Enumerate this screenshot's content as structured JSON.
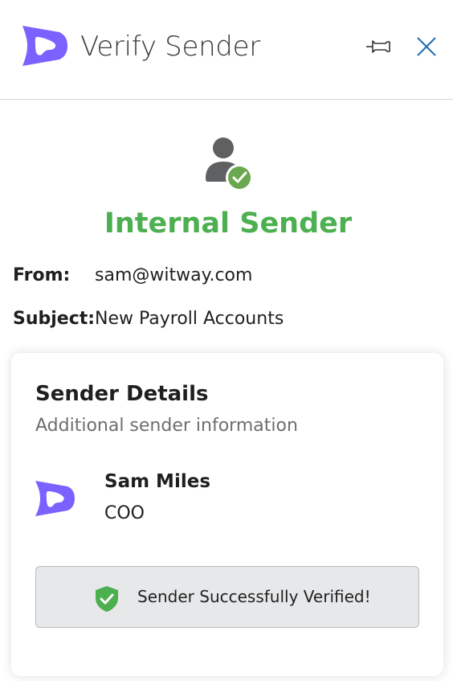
{
  "header": {
    "title": "Verify Sender",
    "logo_icon": "witway-logo-icon",
    "pin_icon": "pin-icon",
    "close_icon": "close-icon"
  },
  "status": {
    "icon": "user-check-icon",
    "title": "Internal Sender",
    "color": "#4caf50"
  },
  "message": {
    "from_label": "From:",
    "from_value": "sam@witway.com",
    "subject_label": "Subject:",
    "subject_value": "New Payroll Accounts"
  },
  "sender_details": {
    "title": "Sender Details",
    "subtitle": "Additional sender information",
    "name": "Sam Miles",
    "role": "COO",
    "logo_color": "#7b61ff",
    "verified_icon": "shield-check-icon",
    "verified_text": "Sender Successfully Verified!"
  }
}
